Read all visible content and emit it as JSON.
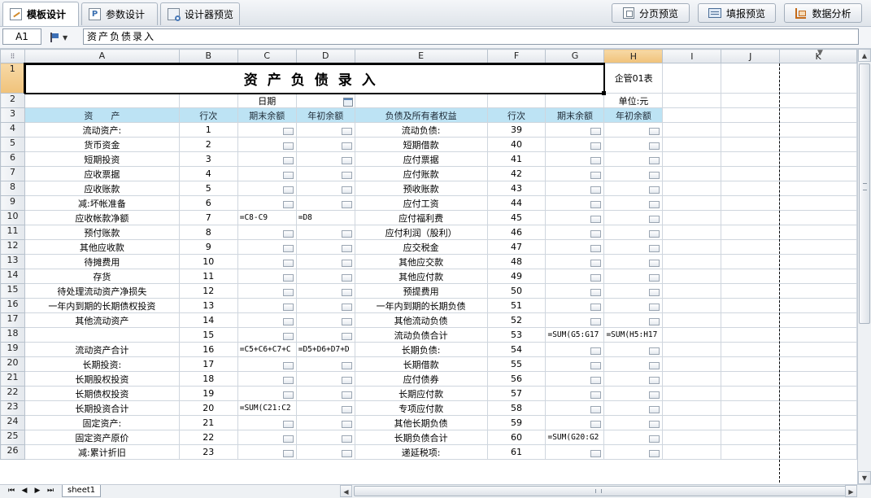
{
  "tabs": [
    {
      "label": "模板设计",
      "icon": "template-icon",
      "active": true
    },
    {
      "label": "参数设计",
      "icon": "parameter-icon",
      "active": false
    },
    {
      "label": "设计器预览",
      "icon": "preview-icon",
      "active": false
    }
  ],
  "toolbar": {
    "page_preview": "分页预览",
    "fill_preview": "填报预览",
    "data_analysis": "数据分析"
  },
  "formula_bar": {
    "cell_ref": "A1",
    "content": "资产负债录入"
  },
  "columns": [
    "A",
    "B",
    "C",
    "D",
    "E",
    "F",
    "G",
    "H",
    "I",
    "J",
    "K"
  ],
  "selected_column": "H",
  "rows": {
    "r1": {
      "title": "资产负债录入",
      "h": "企管01表"
    },
    "r2": {
      "c": "日期",
      "h": "单位:元"
    },
    "r3": {
      "a": "资　　产",
      "b": "行次",
      "c": "期末余额",
      "d": "年初余额",
      "e": "负债及所有者权益",
      "f": "行次",
      "g": "期末余额",
      "h": "年初余额"
    },
    "data": [
      {
        "n": "4",
        "a": "流动资产:",
        "b": "1",
        "c": "",
        "d": "",
        "e": "流动负债:",
        "f": "39",
        "g": "",
        "h": ""
      },
      {
        "n": "5",
        "a": "货币资金",
        "b": "2",
        "c": "",
        "d": "",
        "e": "短期借款",
        "f": "40",
        "g": "",
        "h": ""
      },
      {
        "n": "6",
        "a": "短期投资",
        "b": "3",
        "c": "",
        "d": "",
        "e": "应付票据",
        "f": "41",
        "g": "",
        "h": ""
      },
      {
        "n": "7",
        "a": "应收票据",
        "b": "4",
        "c": "",
        "d": "",
        "e": "应付账款",
        "f": "42",
        "g": "",
        "h": ""
      },
      {
        "n": "8",
        "a": "应收账款",
        "b": "5",
        "c": "",
        "d": "",
        "e": "预收账款",
        "f": "43",
        "g": "",
        "h": ""
      },
      {
        "n": "9",
        "a": "减:坏帐准备",
        "b": "6",
        "c": "",
        "d": "",
        "e": "应付工资",
        "f": "44",
        "g": "",
        "h": ""
      },
      {
        "n": "10",
        "a": "应收帐款净额",
        "b": "7",
        "c": "=C8-C9",
        "d": "=D8",
        "e": "应付福利费",
        "f": "45",
        "g": "",
        "h": ""
      },
      {
        "n": "11",
        "a": "预付账款",
        "b": "8",
        "c": "",
        "d": "",
        "e": "应付利润（股利）",
        "f": "46",
        "g": "",
        "h": ""
      },
      {
        "n": "12",
        "a": "其他应收款",
        "b": "9",
        "c": "",
        "d": "",
        "e": "应交税金",
        "f": "47",
        "g": "",
        "h": ""
      },
      {
        "n": "13",
        "a": "待摊费用",
        "b": "10",
        "c": "",
        "d": "",
        "e": "其他应交款",
        "f": "48",
        "g": "",
        "h": ""
      },
      {
        "n": "14",
        "a": "存货",
        "b": "11",
        "c": "",
        "d": "",
        "e": "其他应付款",
        "f": "49",
        "g": "",
        "h": ""
      },
      {
        "n": "15",
        "a": "待处理流动资产净损失",
        "b": "12",
        "c": "",
        "d": "",
        "e": "预提费用",
        "f": "50",
        "g": "",
        "h": ""
      },
      {
        "n": "16",
        "a": "一年内到期的长期债权投资",
        "b": "13",
        "c": "",
        "d": "",
        "e": "一年内到期的长期负债",
        "f": "51",
        "g": "",
        "h": ""
      },
      {
        "n": "17",
        "a": "其他流动资产",
        "b": "14",
        "c": "",
        "d": "",
        "e": "其他流动负债",
        "f": "52",
        "g": "",
        "h": ""
      },
      {
        "n": "18",
        "a": "",
        "b": "15",
        "c": "",
        "d": "",
        "e": "流动负债合计",
        "f": "53",
        "g": "=SUM(G5:G17",
        "h": "=SUM(H5:H17"
      },
      {
        "n": "19",
        "a": "流动资产合计",
        "b": "16",
        "c": "=C5+C6+C7+C",
        "d": "=D5+D6+D7+D",
        "e": "长期负债:",
        "f": "54",
        "g": "",
        "h": ""
      },
      {
        "n": "20",
        "a": "长期投资:",
        "b": "17",
        "c": "",
        "d": "",
        "e": "长期借款",
        "f": "55",
        "g": "",
        "h": ""
      },
      {
        "n": "21",
        "a": "长期股权投资",
        "b": "18",
        "c": "",
        "d": "",
        "e": "应付债券",
        "f": "56",
        "g": "",
        "h": ""
      },
      {
        "n": "22",
        "a": "长期债权投资",
        "b": "19",
        "c": "",
        "d": "",
        "e": "长期应付款",
        "f": "57",
        "g": "",
        "h": ""
      },
      {
        "n": "23",
        "a": "长期投资合计",
        "b": "20",
        "c": "=SUM(C21:C2",
        "d": "",
        "e": "专项应付款",
        "f": "58",
        "g": "",
        "h": ""
      },
      {
        "n": "24",
        "a": "固定资产:",
        "b": "21",
        "c": "",
        "d": "",
        "e": "其他长期负债",
        "f": "59",
        "g": "",
        "h": ""
      },
      {
        "n": "25",
        "a": "固定资产原价",
        "b": "22",
        "c": "",
        "d": "",
        "e": "长期负债合计",
        "f": "60",
        "g": "=SUM(G20:G2",
        "h": ""
      },
      {
        "n": "26",
        "a": "减:累计折旧",
        "b": "23",
        "c": "",
        "d": "",
        "e": "递延税项:",
        "f": "61",
        "g": "",
        "h": ""
      }
    ]
  },
  "sheet_tab": "sheet1",
  "colors": {
    "accent_header": "#bde3f4",
    "selected_header": "#f0c27a"
  }
}
